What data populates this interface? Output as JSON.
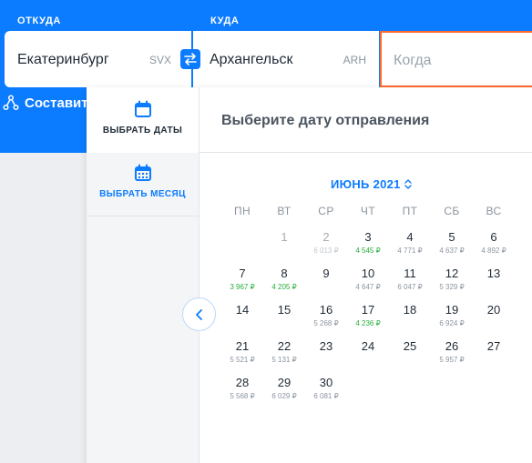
{
  "search": {
    "from_label": "ОТКУДА",
    "to_label": "КУДА",
    "from_city": "Екатеринбург",
    "from_iata": "SVX",
    "to_city": "Архангельск",
    "to_iata": "ARH",
    "when_placeholder": "Когда"
  },
  "compose_label": "Составить",
  "datepicker": {
    "tab_dates": "ВЫБРАТЬ ДАТЫ",
    "tab_month": "ВЫБРАТЬ МЕСЯЦ",
    "title": "Выберите дату отправления",
    "month": "ИЮНЬ 2021",
    "weekdays": [
      "ПН",
      "ВТ",
      "СР",
      "ЧТ",
      "ПТ",
      "СБ",
      "ВС"
    ],
    "days": [
      {
        "day": "1",
        "price": "",
        "status": "past"
      },
      {
        "day": "2",
        "price": "6 013 ₽",
        "status": "past"
      },
      {
        "day": "3",
        "price": "4 545 ₽",
        "status": "cheap"
      },
      {
        "day": "4",
        "price": "4 771 ₽",
        "status": "normal"
      },
      {
        "day": "5",
        "price": "4 637 ₽",
        "status": "normal"
      },
      {
        "day": "6",
        "price": "4 892 ₽",
        "status": "normal"
      },
      {
        "day": "7",
        "price": "3 967 ₽",
        "status": "cheap"
      },
      {
        "day": "8",
        "price": "4 205 ₽",
        "status": "cheap"
      },
      {
        "day": "9",
        "price": "",
        "status": "normal"
      },
      {
        "day": "10",
        "price": "4 647 ₽",
        "status": "normal"
      },
      {
        "day": "11",
        "price": "6 047 ₽",
        "status": "normal"
      },
      {
        "day": "12",
        "price": "5 329 ₽",
        "status": "normal"
      },
      {
        "day": "13",
        "price": "",
        "status": "normal"
      },
      {
        "day": "14",
        "price": "",
        "status": "normal"
      },
      {
        "day": "15",
        "price": "",
        "status": "normal"
      },
      {
        "day": "16",
        "price": "5 268 ₽",
        "status": "normal"
      },
      {
        "day": "17",
        "price": "4 236 ₽",
        "status": "cheap"
      },
      {
        "day": "18",
        "price": "",
        "status": "normal"
      },
      {
        "day": "19",
        "price": "6 924 ₽",
        "status": "normal"
      },
      {
        "day": "20",
        "price": "",
        "status": "normal"
      },
      {
        "day": "21",
        "price": "5 521 ₽",
        "status": "normal"
      },
      {
        "day": "22",
        "price": "5 131 ₽",
        "status": "normal"
      },
      {
        "day": "23",
        "price": "",
        "status": "normal"
      },
      {
        "day": "24",
        "price": "",
        "status": "normal"
      },
      {
        "day": "25",
        "price": "",
        "status": "normal"
      },
      {
        "day": "26",
        "price": "5 957 ₽",
        "status": "normal"
      },
      {
        "day": "27",
        "price": "",
        "status": "normal"
      },
      {
        "day": "28",
        "price": "5 568 ₽",
        "status": "normal"
      },
      {
        "day": "29",
        "price": "6 029 ₽",
        "status": "normal"
      },
      {
        "day": "30",
        "price": "6 081 ₽",
        "status": "normal"
      }
    ]
  },
  "icons": {
    "swap": "swap-arrows-icon",
    "compose": "route-nodes-icon",
    "tab_dates": "calendar-icon",
    "tab_month": "calendar-grid-icon",
    "month_toggle": "chevron-up-down-icon",
    "prev": "chevron-left-icon"
  },
  "colors": {
    "brand_blue": "#0b7bff",
    "focus_orange": "#ff6a2b",
    "cheap_green": "#27ae3c"
  }
}
